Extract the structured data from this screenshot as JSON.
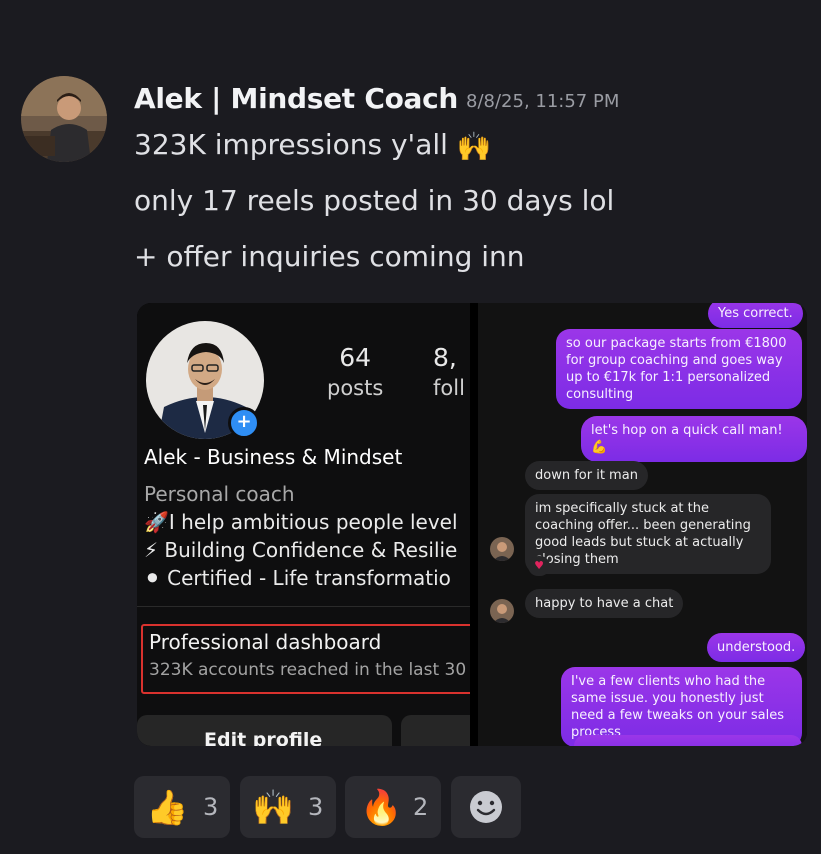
{
  "message": {
    "author": "Alek | Mindset Coach",
    "timestamp": "8/8/25, 11:57 PM",
    "lines": [
      "323K impressions y'all",
      "only 17 reels posted in 30 days lol",
      "+ offer inquiries coming inn"
    ],
    "line1_emoji": "🙌"
  },
  "instagram_profile": {
    "posts_count": "64",
    "posts_label": "posts",
    "followers_count": "8,",
    "followers_label": "foll",
    "add_story_icon": "+",
    "name": "Alek - Business & Mindset",
    "category": "Personal coach",
    "bio": [
      {
        "icon": "🚀",
        "text": "I help ambitious people level"
      },
      {
        "icon": "⚡",
        "text": "Building Confidence & Resilie"
      },
      {
        "icon": "⚫",
        "text": "Certified - Life transformatio"
      }
    ],
    "dashboard_title": "Professional dashboard",
    "dashboard_sub": "323K accounts reached in the last 30",
    "edit_profile_label": "Edit profile"
  },
  "chat": {
    "messages": [
      {
        "dir": "out",
        "text": "Yes correct."
      },
      {
        "dir": "out",
        "text": "so our package starts from €1800 for group coaching and goes way up to €17k for 1:1 personalized consulting"
      },
      {
        "dir": "out",
        "text": "let's hop on a quick call man! 💪"
      },
      {
        "dir": "in",
        "text": "down for it man"
      },
      {
        "dir": "in",
        "text": "im specifically stuck at the coaching offer... been generating good leads but stuck at actually closing them"
      },
      {
        "dir": "in",
        "text": "happy to have a chat"
      },
      {
        "dir": "out",
        "text": "understood."
      },
      {
        "dir": "out",
        "text": "I've a few clients who had the same issue. you honestly just need a few tweaks on your sales process"
      }
    ],
    "reaction_heart": "♥"
  },
  "reactions": [
    {
      "emoji": "👍",
      "count": "3"
    },
    {
      "emoji": "🙌",
      "count": "3"
    },
    {
      "emoji": "🔥",
      "count": "2"
    }
  ],
  "add_reaction_icon": "smiley-face-icon",
  "colors": {
    "background": "#1b1b20",
    "outgoing_bubble": "#8a2ce0",
    "dashboard_border": "#d9322e"
  }
}
